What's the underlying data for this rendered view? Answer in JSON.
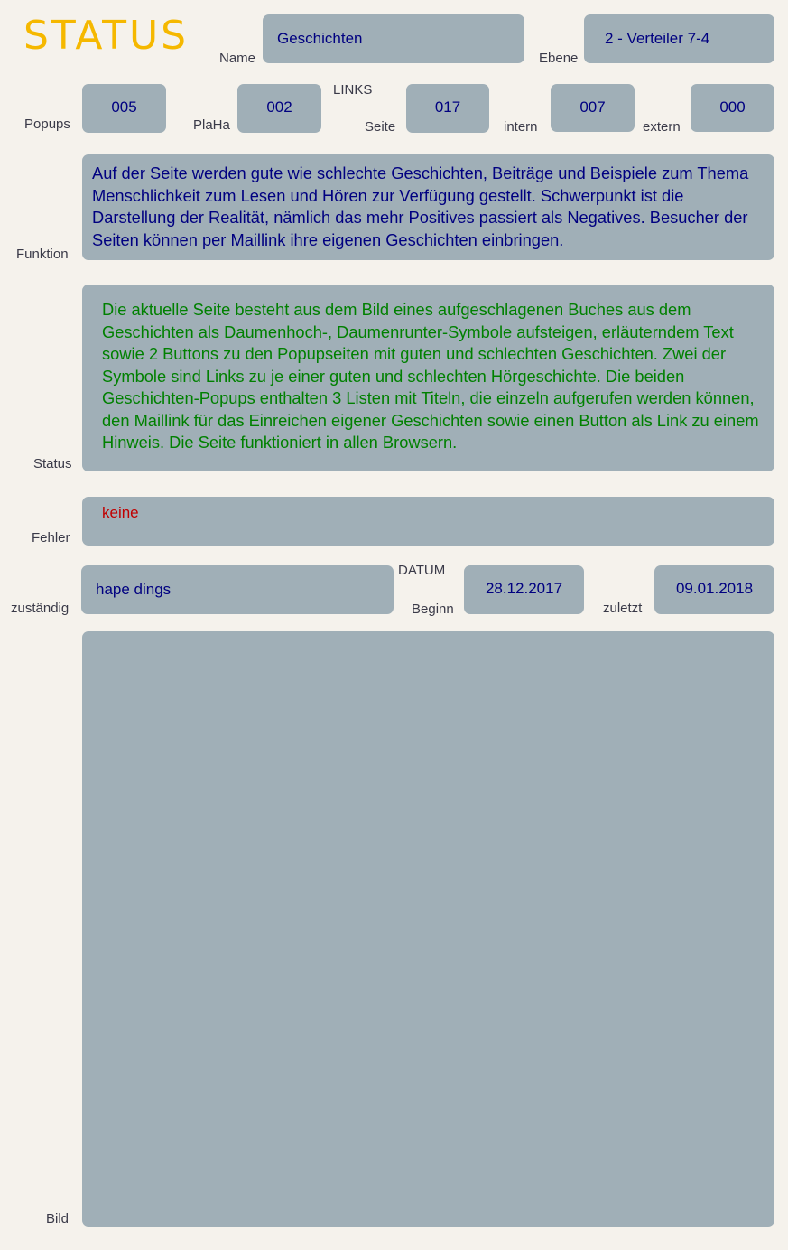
{
  "header": {
    "title": "STATUS",
    "name_label": "Name",
    "name_value": "Geschichten",
    "ebene_label": "Ebene",
    "ebene_value": "2 - Verteiler 7-4"
  },
  "counts": {
    "popups_label": "Popups",
    "popups_value": "005",
    "plaha_label": "PlaHa",
    "plaha_value": "002",
    "links_heading": "LINKS",
    "seite_label": "Seite",
    "seite_value": "017",
    "intern_label": "intern",
    "intern_value": "007",
    "extern_label": "extern",
    "extern_value": "000"
  },
  "funktion": {
    "label": "Funktion",
    "text": "Auf der Seite werden gute wie schlechte Geschichten, Beiträge und Beispiele zum Thema Menschlichkeit zum Lesen und Hören zur Verfügung gestellt. Schwerpunkt ist die Darstellung der Realität, nämlich das mehr Positives passiert als Negatives. Besucher der Seiten können per Maillink ihre eigenen Geschichten einbringen."
  },
  "status": {
    "label": "Status",
    "text": "Die aktuelle Seite besteht aus dem Bild eines aufgeschlagenen Buches aus dem Geschichten als Daumenhoch-, Daumenrunter-Symbole aufsteigen, erläuterndem Text sowie 2 Buttons zu den Popupseiten mit guten und schlechten Geschichten. Zwei der Symbole sind Links zu je einer guten und schlechten Hörgeschichte. Die beiden Geschichten-Popups enthalten 3 Listen mit Titeln, die einzeln aufgerufen werden können, den Maillink für das Einreichen eigener Geschichten sowie einen Button als Link zu einem Hinweis. Die Seite funktioniert in allen Browsern."
  },
  "fehler": {
    "label": "Fehler",
    "text": "keine"
  },
  "meta": {
    "zustaendig_label": "zuständig",
    "zustaendig_value": "hape dings",
    "datum_heading": "DATUM",
    "beginn_label": "Beginn",
    "beginn_value": "28.12.2017",
    "zuletzt_label": "zuletzt",
    "zuletzt_value": "09.01.2018"
  },
  "bild": {
    "label": "Bild"
  },
  "colors": {
    "title": "#f5b800",
    "field_bg": "#a0afb7",
    "page_bg": "#f5f2ec",
    "value_text": "#000080",
    "status_text": "#008000",
    "error_text": "#c00000"
  }
}
